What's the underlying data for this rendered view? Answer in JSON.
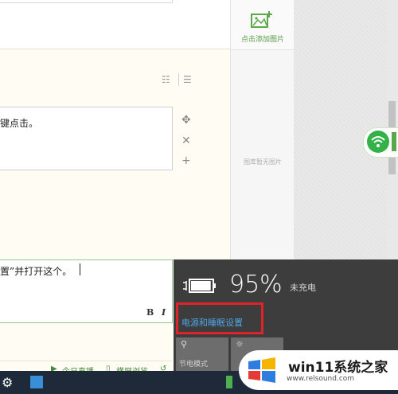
{
  "editor": {
    "step_text": "键点击。",
    "step_text2": "置”并打开这个。",
    "format": {
      "bold": "B",
      "italic": "I"
    }
  },
  "toolbar": {
    "live_label": "今日直播",
    "landscape_label": "横屏浏览"
  },
  "gallery": {
    "add_label": "点击添加图片",
    "empty_text": "图库暂无图片"
  },
  "power": {
    "percent": "95%",
    "status": "未充电",
    "link": "电源和睡眠设置",
    "tile_saver": "节电模式",
    "level": 0.95
  },
  "watermark": {
    "title": "win11系统之家",
    "url": "www.relsound.com"
  }
}
